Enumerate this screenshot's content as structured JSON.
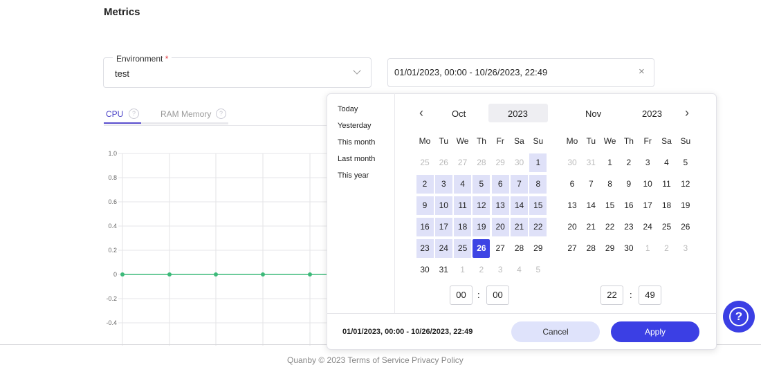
{
  "page_title": "Metrics",
  "environment": {
    "label": "Environment",
    "required_mark": "*",
    "value": "test"
  },
  "date_range": {
    "value": "01/01/2023, 00:00 - 10/26/2023, 22:49",
    "clear_icon": "×"
  },
  "tabs": [
    {
      "label": "CPU",
      "active": true
    },
    {
      "label": "RAM Memory",
      "active": false
    }
  ],
  "help_glyph": "?",
  "chart_data": {
    "type": "line",
    "y_ticks": [
      "1.0",
      "0.8",
      "0.6",
      "0.4",
      "0.2",
      "0",
      "-0.2",
      "-0.4"
    ],
    "ylim": [
      -0.58,
      1.0
    ],
    "series": [
      {
        "name": "CPU",
        "color": "#3dba7a",
        "values": [
          0,
          0,
          0,
          0,
          0,
          0
        ]
      }
    ],
    "grid": true
  },
  "footer": {
    "text": "Quanby © 2023   Terms of Service   Privacy Policy"
  },
  "picker": {
    "presets": [
      "Today",
      "Yesterday",
      "This month",
      "Last month",
      "This year"
    ],
    "weekdays": [
      "Mo",
      "Tu",
      "We",
      "Th",
      "Fr",
      "Sa",
      "Su"
    ],
    "left": {
      "month": "Oct",
      "year": "2023",
      "weeks": [
        [
          "25",
          "26",
          "27",
          "28",
          "29",
          "30",
          "1"
        ],
        [
          "2",
          "3",
          "4",
          "5",
          "6",
          "7",
          "8"
        ],
        [
          "9",
          "10",
          "11",
          "12",
          "13",
          "14",
          "15"
        ],
        [
          "16",
          "17",
          "18",
          "19",
          "20",
          "21",
          "22"
        ],
        [
          "23",
          "24",
          "25",
          "26",
          "27",
          "28",
          "29"
        ],
        [
          "30",
          "31",
          "1",
          "2",
          "3",
          "4",
          "5"
        ]
      ],
      "states": [
        [
          "m",
          "m",
          "m",
          "m",
          "m",
          "m",
          "r"
        ],
        [
          "r",
          "r",
          "r",
          "r",
          "r",
          "r",
          "r"
        ],
        [
          "r",
          "r",
          "r",
          "r",
          "r",
          "r",
          "r"
        ],
        [
          "r",
          "r",
          "r",
          "r",
          "r",
          "r",
          "r"
        ],
        [
          "r",
          "r",
          "r",
          "s",
          "",
          "",
          ""
        ],
        [
          "",
          "",
          "m",
          "m",
          "m",
          "m",
          "m"
        ]
      ],
      "hour": "00",
      "minute": "00"
    },
    "right": {
      "month": "Nov",
      "year": "2023",
      "weeks": [
        [
          "30",
          "31",
          "1",
          "2",
          "3",
          "4",
          "5"
        ],
        [
          "6",
          "7",
          "8",
          "9",
          "10",
          "11",
          "12"
        ],
        [
          "13",
          "14",
          "15",
          "16",
          "17",
          "18",
          "19"
        ],
        [
          "20",
          "21",
          "22",
          "23",
          "24",
          "25",
          "26"
        ],
        [
          "27",
          "28",
          "29",
          "30",
          "1",
          "2",
          "3"
        ]
      ],
      "states": [
        [
          "m",
          "m",
          "",
          "",
          "",
          "",
          ""
        ],
        [
          "",
          "",
          "",
          "",
          "",
          "",
          ""
        ],
        [
          "",
          "",
          "",
          "",
          "",
          "",
          ""
        ],
        [
          "",
          "",
          "",
          "",
          "",
          "",
          ""
        ],
        [
          "",
          "",
          "",
          "",
          "m",
          "m",
          "m"
        ]
      ],
      "hour": "22",
      "minute": "49"
    },
    "time_sep": ":",
    "nav_prev": "‹",
    "nav_next": "›",
    "range_text": "01/01/2023, 00:00 - 10/26/2023, 22:49",
    "cancel_label": "Cancel",
    "apply_label": "Apply"
  }
}
